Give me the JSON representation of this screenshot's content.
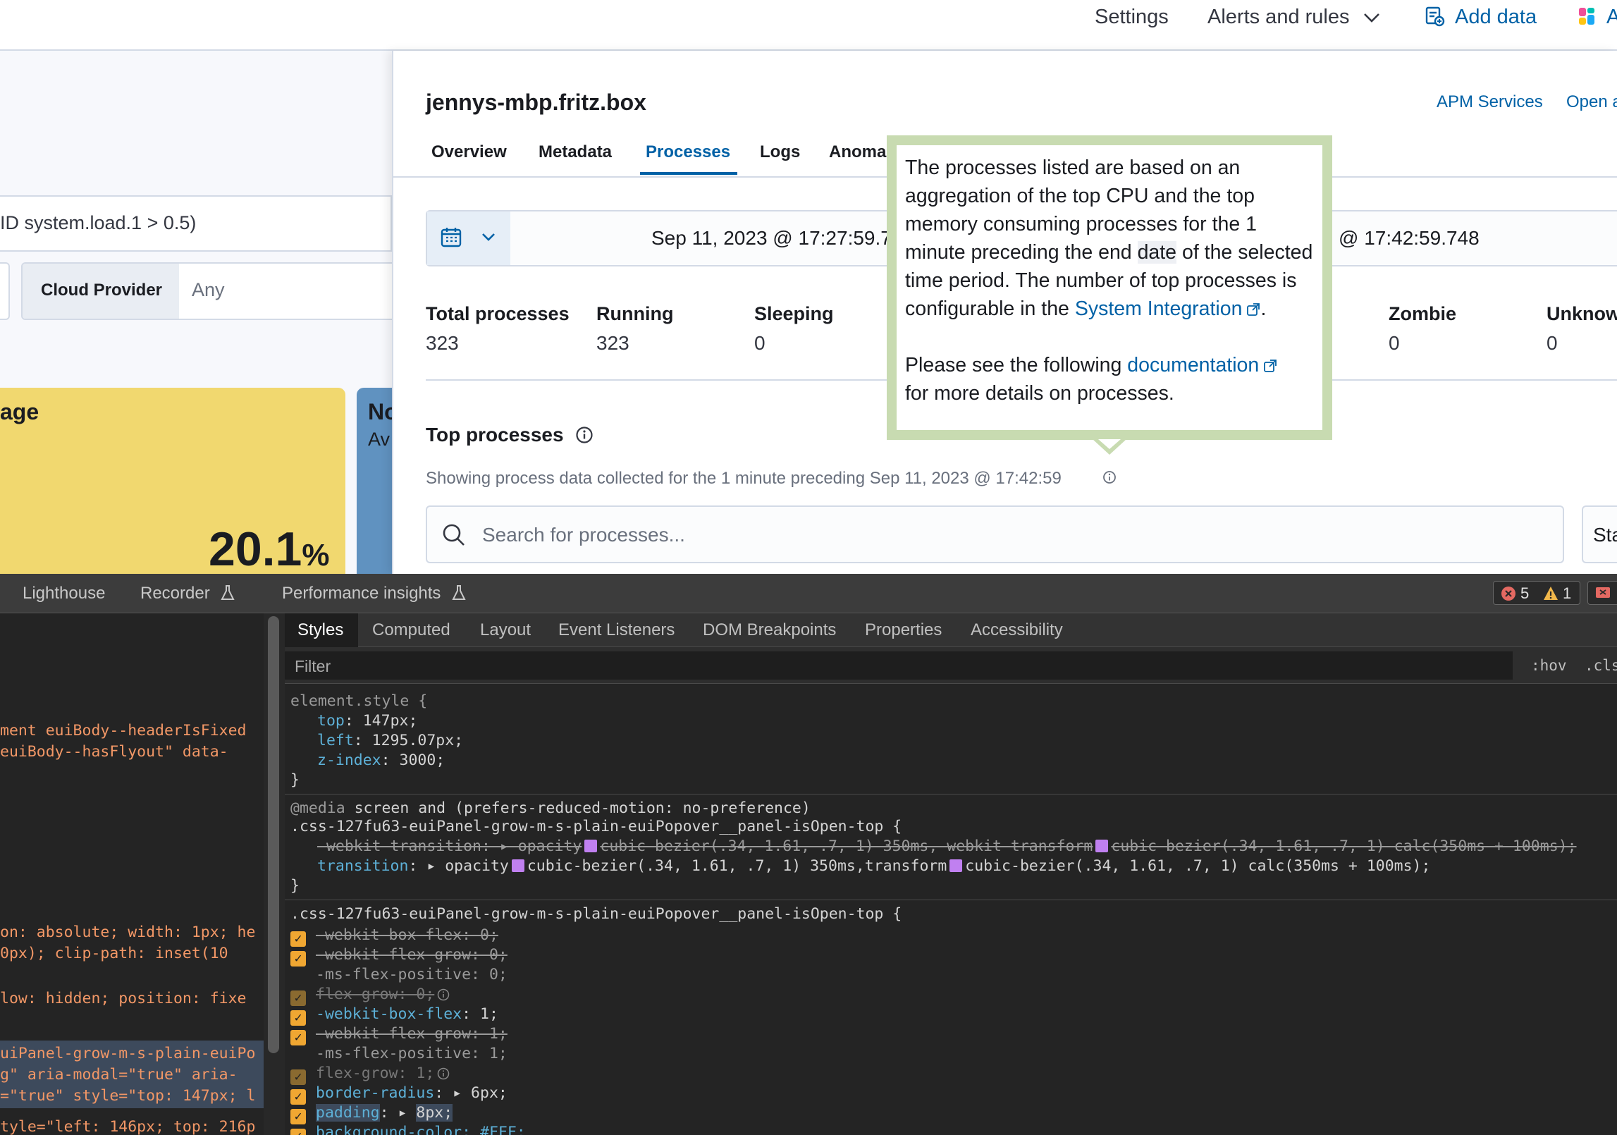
{
  "header": {
    "settings": "Settings",
    "alerts": "Alerts and rules",
    "add_data": "Add data",
    "cut_letter": "A"
  },
  "left": {
    "query": "ID system.load.1 > 0.5)",
    "cloud_label": "Cloud Provider",
    "cloud_value": "Any",
    "card_title": "age",
    "card_value": "20.1",
    "card_unit": "%",
    "card2_title": "No",
    "card2_sub": "Av"
  },
  "flyout": {
    "title": "jennys-mbp.fritz.box",
    "apm_link": "APM Services",
    "open_link": "Open a",
    "tabs": [
      "Overview",
      "Metadata",
      "Processes",
      "Logs",
      "Anoma"
    ],
    "date_start": "Sep 11, 2023 @ 17:27:59.7",
    "date_end": "@ 17:42:59.748",
    "stats": [
      {
        "label": "Total processes",
        "value": "323"
      },
      {
        "label": "Running",
        "value": "323"
      },
      {
        "label": "Sleeping",
        "value": "0"
      },
      {
        "label": "Zombie",
        "value": "0"
      },
      {
        "label": "Unknow",
        "value": "0"
      }
    ],
    "top_processes": "Top processes",
    "showing": "Showing process data collected for the 1 minute preceding Sep 11, 2023 @ 17:42:59",
    "search_placeholder": "Search for processes...",
    "state_btn": "Sta"
  },
  "popover": {
    "p1a": "The processes listed are based on an aggregation of the top CPU and the top memory consuming processes for the 1 minute preceding the end ",
    "p1b": "date",
    "p1c": " of the selected time period. The number of top processes is configurable in the ",
    "link1": "System Integration",
    "p1d": ".",
    "p2a": "Please see the following ",
    "link2": "documentation",
    "p2b": "for more details on processes."
  },
  "devtools": {
    "top_tabs": [
      "Lighthouse",
      "Recorder",
      "Performance insights"
    ],
    "errors": "5",
    "warnings": "1",
    "styles_tabs": [
      "Styles",
      "Computed",
      "Layout",
      "Event Listeners",
      "DOM Breakpoints",
      "Properties",
      "Accessibility"
    ],
    "filter": "Filter",
    "hov": ":hov",
    "cls": ".cls",
    "elements_lines": [
      "ment euiBody--headerIsFixed",
      "euiBody--hasFlyout\" data-",
      "on: absolute; width: 1px; he",
      " 0px); clip-path: inset(10",
      "low: hidden; position: fixe",
      "uiPanel-grow-m-s-plain-euiPo",
      "g\" aria-modal=\"true\" aria-",
      "=\"true\" style=\"top: 147px; l",
      "tyle=\"left: 146px; top: 216p"
    ],
    "css": {
      "element_style": "element.style {",
      "top": "top",
      "top_val": "147px;",
      "left": "left",
      "left_val": "1295.07px;",
      "zindex": "z-index",
      "zindex_val": "3000;",
      "close": "}",
      "media": "@media",
      "media_rest": " screen and (prefers-reduced-motion: no-preference)",
      "selector": ".css-127fu63-euiPanel-grow-m-s-plain-euiPopover__panel-isOpen-top {",
      "wk_transition": "-webkit-transition: ▸ opacity",
      "wk_transition_rest": "cubic-bezier(.34, 1.61, .7, 1) 350ms,-webkit-transform",
      "wk_transition_rest2": "cubic-bezier(.34, 1.61, .7, 1) calc(350ms + 100ms);",
      "transition": "transition",
      "transition_val": "▸ opacity",
      "transition_rest": "cubic-bezier(.34, 1.61, .7, 1) 350ms,transform",
      "transition_rest2": "cubic-bezier(.34, 1.61, .7, 1) calc(350ms + 100ms);",
      "r1": "-webkit-box-flex: 0;",
      "r2": "-webkit-flex-grow: 0;",
      "r3": "-ms-flex-positive: 0;",
      "r4": "flex-grow: 0;",
      "r5p": "-webkit-box-flex",
      "r5v": "1;",
      "r6": "-webkit-flex-grow: 1;",
      "r7": "-ms-flex-positive: 1;",
      "r8": "flex-grow: 1;",
      "r9p": "border-radius",
      "r9v": "▸ 6px;",
      "r10p": "padding",
      "r10v": "8px;",
      "r11": "background-color: #FFF;"
    }
  },
  "colors": {
    "accent": "#0061a6",
    "popover_border": "#c8dbb1",
    "card_yellow": "#f1d86f",
    "card_blue": "#6092c0"
  }
}
